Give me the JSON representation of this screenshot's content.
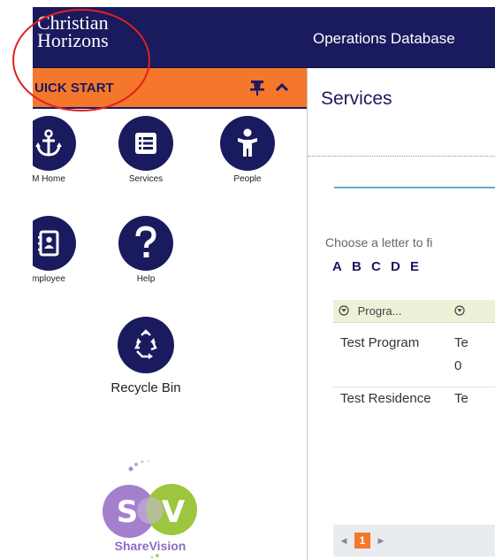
{
  "header": {
    "logo_line1": "Christian",
    "logo_line2": "Horizons",
    "app_title": "Operations Database"
  },
  "sidebar": {
    "quick_start_label": "UICK START",
    "tiles": [
      {
        "label": "M Home",
        "icon": "anchor-icon"
      },
      {
        "label": "Services",
        "icon": "list-icon"
      },
      {
        "label": "People",
        "icon": "person-icon"
      },
      {
        "label": "mployee",
        "icon": "contact-book-icon"
      },
      {
        "label": "Help",
        "icon": "question-icon"
      },
      {
        "label": "Recycle Bin",
        "icon": "recycle-icon"
      }
    ],
    "sharevision_letters": "SV",
    "sharevision_label": "ShareVision"
  },
  "main": {
    "page_title": "Services",
    "filter_prompt": "Choose a letter to fi",
    "letters": [
      "A",
      "B",
      "C",
      "D",
      "E"
    ],
    "columns": [
      "Progra...",
      ""
    ],
    "rows": [
      {
        "name": "Test Program",
        "second": "Te",
        "third": "0"
      },
      {
        "name": "Test Residence",
        "second": "Te",
        "third": ""
      }
    ],
    "pager": {
      "current_page": "1"
    }
  },
  "colors": {
    "navy": "#1a1a5e",
    "orange": "#f5772b",
    "annotation_red": "#e02020"
  }
}
